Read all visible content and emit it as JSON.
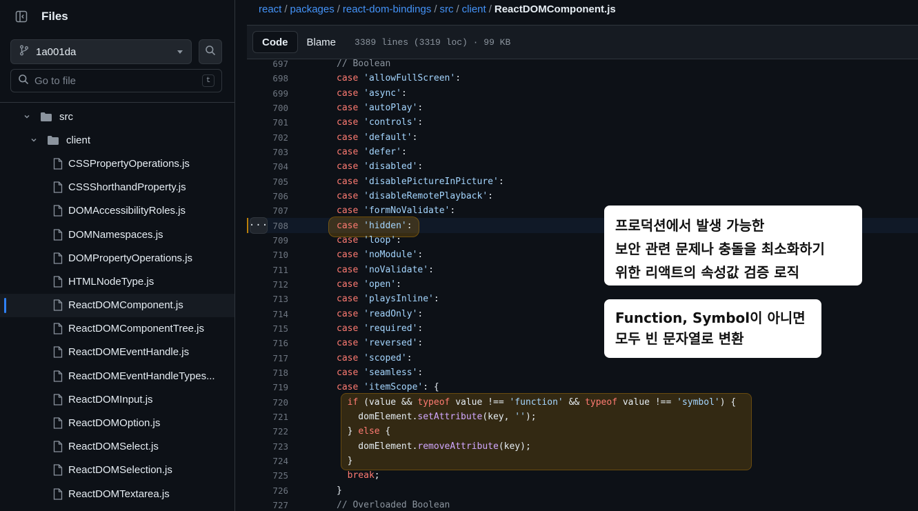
{
  "sidebar": {
    "title": "Files",
    "branch": "1a001da",
    "goto_placeholder": "Go to file",
    "goto_shortcut": "t",
    "tree": [
      {
        "type": "folder",
        "label": "src",
        "depth": 0
      },
      {
        "type": "folder",
        "label": "client",
        "depth": 1
      },
      {
        "type": "file",
        "label": "CSSPropertyOperations.js"
      },
      {
        "type": "file",
        "label": "CSSShorthandProperty.js"
      },
      {
        "type": "file",
        "label": "DOMAccessibilityRoles.js"
      },
      {
        "type": "file",
        "label": "DOMNamespaces.js"
      },
      {
        "type": "file",
        "label": "DOMPropertyOperations.js"
      },
      {
        "type": "file",
        "label": "HTMLNodeType.js"
      },
      {
        "type": "file",
        "label": "ReactDOMComponent.js",
        "active": true
      },
      {
        "type": "file",
        "label": "ReactDOMComponentTree.js"
      },
      {
        "type": "file",
        "label": "ReactDOMEventHandle.js"
      },
      {
        "type": "file",
        "label": "ReactDOMEventHandleTypes..."
      },
      {
        "type": "file",
        "label": "ReactDOMInput.js"
      },
      {
        "type": "file",
        "label": "ReactDOMOption.js"
      },
      {
        "type": "file",
        "label": "ReactDOMSelect.js"
      },
      {
        "type": "file",
        "label": "ReactDOMSelection.js"
      },
      {
        "type": "file",
        "label": "ReactDOMTextarea.js"
      }
    ]
  },
  "breadcrumb": {
    "parts": [
      "react",
      "packages",
      "react-dom-bindings",
      "src",
      "client"
    ],
    "separator": "/",
    "current": "ReactDOMComponent.js"
  },
  "toolbar": {
    "code_label": "Code",
    "blame_label": "Blame",
    "file_meta": "3389 lines (3319 loc) · 99 KB"
  },
  "code": {
    "lines": [
      {
        "n": "697",
        "text": "// Boolean"
      },
      {
        "n": "698",
        "text": "case 'allowFullScreen':"
      },
      {
        "n": "699",
        "text": "case 'async':"
      },
      {
        "n": "700",
        "text": "case 'autoPlay':"
      },
      {
        "n": "701",
        "text": "case 'controls':"
      },
      {
        "n": "702",
        "text": "case 'default':"
      },
      {
        "n": "703",
        "text": "case 'defer':"
      },
      {
        "n": "704",
        "text": "case 'disabled':"
      },
      {
        "n": "705",
        "text": "case 'disablePictureInPicture':"
      },
      {
        "n": "706",
        "text": "case 'disableRemotePlayback':"
      },
      {
        "n": "707",
        "text": "case 'formNoValidate':"
      },
      {
        "n": "708",
        "text": "case 'hidden':"
      },
      {
        "n": "709",
        "text": "case 'loop':"
      },
      {
        "n": "710",
        "text": "case 'noModule':"
      },
      {
        "n": "711",
        "text": "case 'noValidate':"
      },
      {
        "n": "712",
        "text": "case 'open':"
      },
      {
        "n": "713",
        "text": "case 'playsInline':"
      },
      {
        "n": "714",
        "text": "case 'readOnly':"
      },
      {
        "n": "715",
        "text": "case 'required':"
      },
      {
        "n": "716",
        "text": "case 'reversed':"
      },
      {
        "n": "717",
        "text": "case 'scoped':"
      },
      {
        "n": "718",
        "text": "case 'seamless':"
      },
      {
        "n": "719",
        "text": "case 'itemScope': {"
      },
      {
        "n": "720",
        "text": "  if (value && typeof value !== 'function' && typeof value !== 'symbol') {"
      },
      {
        "n": "721",
        "text": "    domElement.setAttribute(key, '');"
      },
      {
        "n": "722",
        "text": "  } else {"
      },
      {
        "n": "723",
        "text": "    domElement.removeAttribute(key);"
      },
      {
        "n": "724",
        "text": "  }"
      },
      {
        "n": "725",
        "text": "  break;"
      },
      {
        "n": "726",
        "text": "}"
      },
      {
        "n": "727",
        "text": "// Overloaded Boolean"
      }
    ]
  },
  "callouts": {
    "first": [
      "프로덕션에서 발생 가능한",
      "보안 관련 문제나 충돌을 최소화하기",
      "위한 리액트의 속성값 검증 로직"
    ],
    "second": [
      "Function, Symbol이 아니면",
      "모두 빈 문자열로 변환"
    ]
  },
  "line_menu_label": "···",
  "colors": {
    "background": "#0d1117",
    "link": "#4493f8",
    "keyword": "#ff7b72",
    "string": "#a5d6ff",
    "highlight": "#bb8009"
  }
}
